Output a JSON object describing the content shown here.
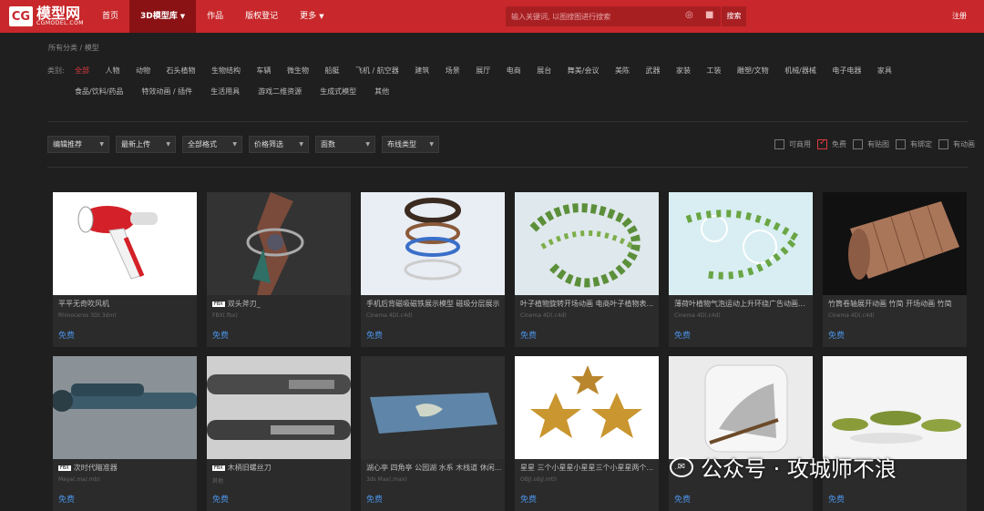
{
  "header": {
    "logo_text": "模型网",
    "logo_sub": "CGMODEL.COM",
    "logo_mark": "CG",
    "nav": [
      {
        "label": "首页"
      },
      {
        "label": "3D模型库"
      },
      {
        "label": "作品"
      },
      {
        "label": "版权登记"
      },
      {
        "label": "更多"
      }
    ],
    "search_placeholder": "输入关键词, 以图搜图进行搜索",
    "search_button": "搜索",
    "register": "注册"
  },
  "breadcrumb": "所有分类 / 模型",
  "categories": {
    "label": "类别:",
    "row1": [
      "全部",
      "人物",
      "动物",
      "石头植物",
      "生物结构",
      "车辆",
      "微生物",
      "船艇",
      "飞机 / 航空器",
      "建筑",
      "场景",
      "展厅",
      "电商",
      "展台",
      "舞美/会议",
      "美陈",
      "武器",
      "家装",
      "工装",
      "雕塑/文物",
      "机械/器械",
      "电子电器",
      "家具"
    ],
    "row2": [
      "食品/饮料/药品",
      "特效动画 / 插件",
      "生活用具",
      "游戏二维资源",
      "生成式模型",
      "其他"
    ],
    "selected": "全部"
  },
  "filters": [
    {
      "label": "编辑推荐"
    },
    {
      "label": "最新上传"
    },
    {
      "label": "全部格式"
    },
    {
      "label": "价格筛选"
    },
    {
      "label": "面数"
    },
    {
      "label": "布线类型"
    }
  ],
  "checkboxes": [
    {
      "label": "可商用",
      "checked": false
    },
    {
      "label": "免费",
      "checked": true
    },
    {
      "label": "有贴图",
      "checked": false
    },
    {
      "label": "有绑定",
      "checked": false
    },
    {
      "label": "有动画",
      "checked": false
    }
  ],
  "cards": [
    {
      "title": "平平无奇吹风机",
      "format": "Rhinoceros 3D(.3dm)",
      "price": "免费",
      "tag": ""
    },
    {
      "title": "双头斧刃_",
      "format": "FBX(.fbx)",
      "price": "免费",
      "tag": "FBX"
    },
    {
      "title": "手机后背磁吸磁铁展示模型 磁吸分层展示",
      "format": "Cinema 4D(.c4d)",
      "price": "免费",
      "tag": ""
    },
    {
      "title": "叶子植物旋转开场动画 电商叶子植物表...",
      "format": "Cinema 4D(.c4d)",
      "price": "免费",
      "tag": ""
    },
    {
      "title": "薄荷叶植物气泡运动上升环绕广告动画...",
      "format": "Cinema 4D(.c4d)",
      "price": "免费",
      "tag": ""
    },
    {
      "title": "竹筒卷轴展开动画 竹简 开场动画 竹简",
      "format": "Cinema 4D(.c4d)",
      "price": "免费",
      "tag": ""
    },
    {
      "title": "次时代瞄准器",
      "format": "Maya(.ma/.mb)",
      "price": "免费",
      "tag": "FBX"
    },
    {
      "title": "木柄旧螺丝刀",
      "format": "其他",
      "price": "免费",
      "tag": "FBX"
    },
    {
      "title": "湖心亭 四角亭 公园湖 水系 木栈道 休闲...",
      "format": "3ds Max(.max)",
      "price": "免费",
      "tag": ""
    },
    {
      "title": "星星 三个小星星小星星三个小星星两个...",
      "format": "OBJ(.obj/.mtl)",
      "price": "免费",
      "tag": ""
    },
    {
      "title": "...",
      "format": "",
      "price": "免费",
      "tag": ""
    },
    {
      "title": "",
      "format": "",
      "price": "免费",
      "tag": ""
    }
  ],
  "watermark": "公众号 · 攻城师不浪"
}
